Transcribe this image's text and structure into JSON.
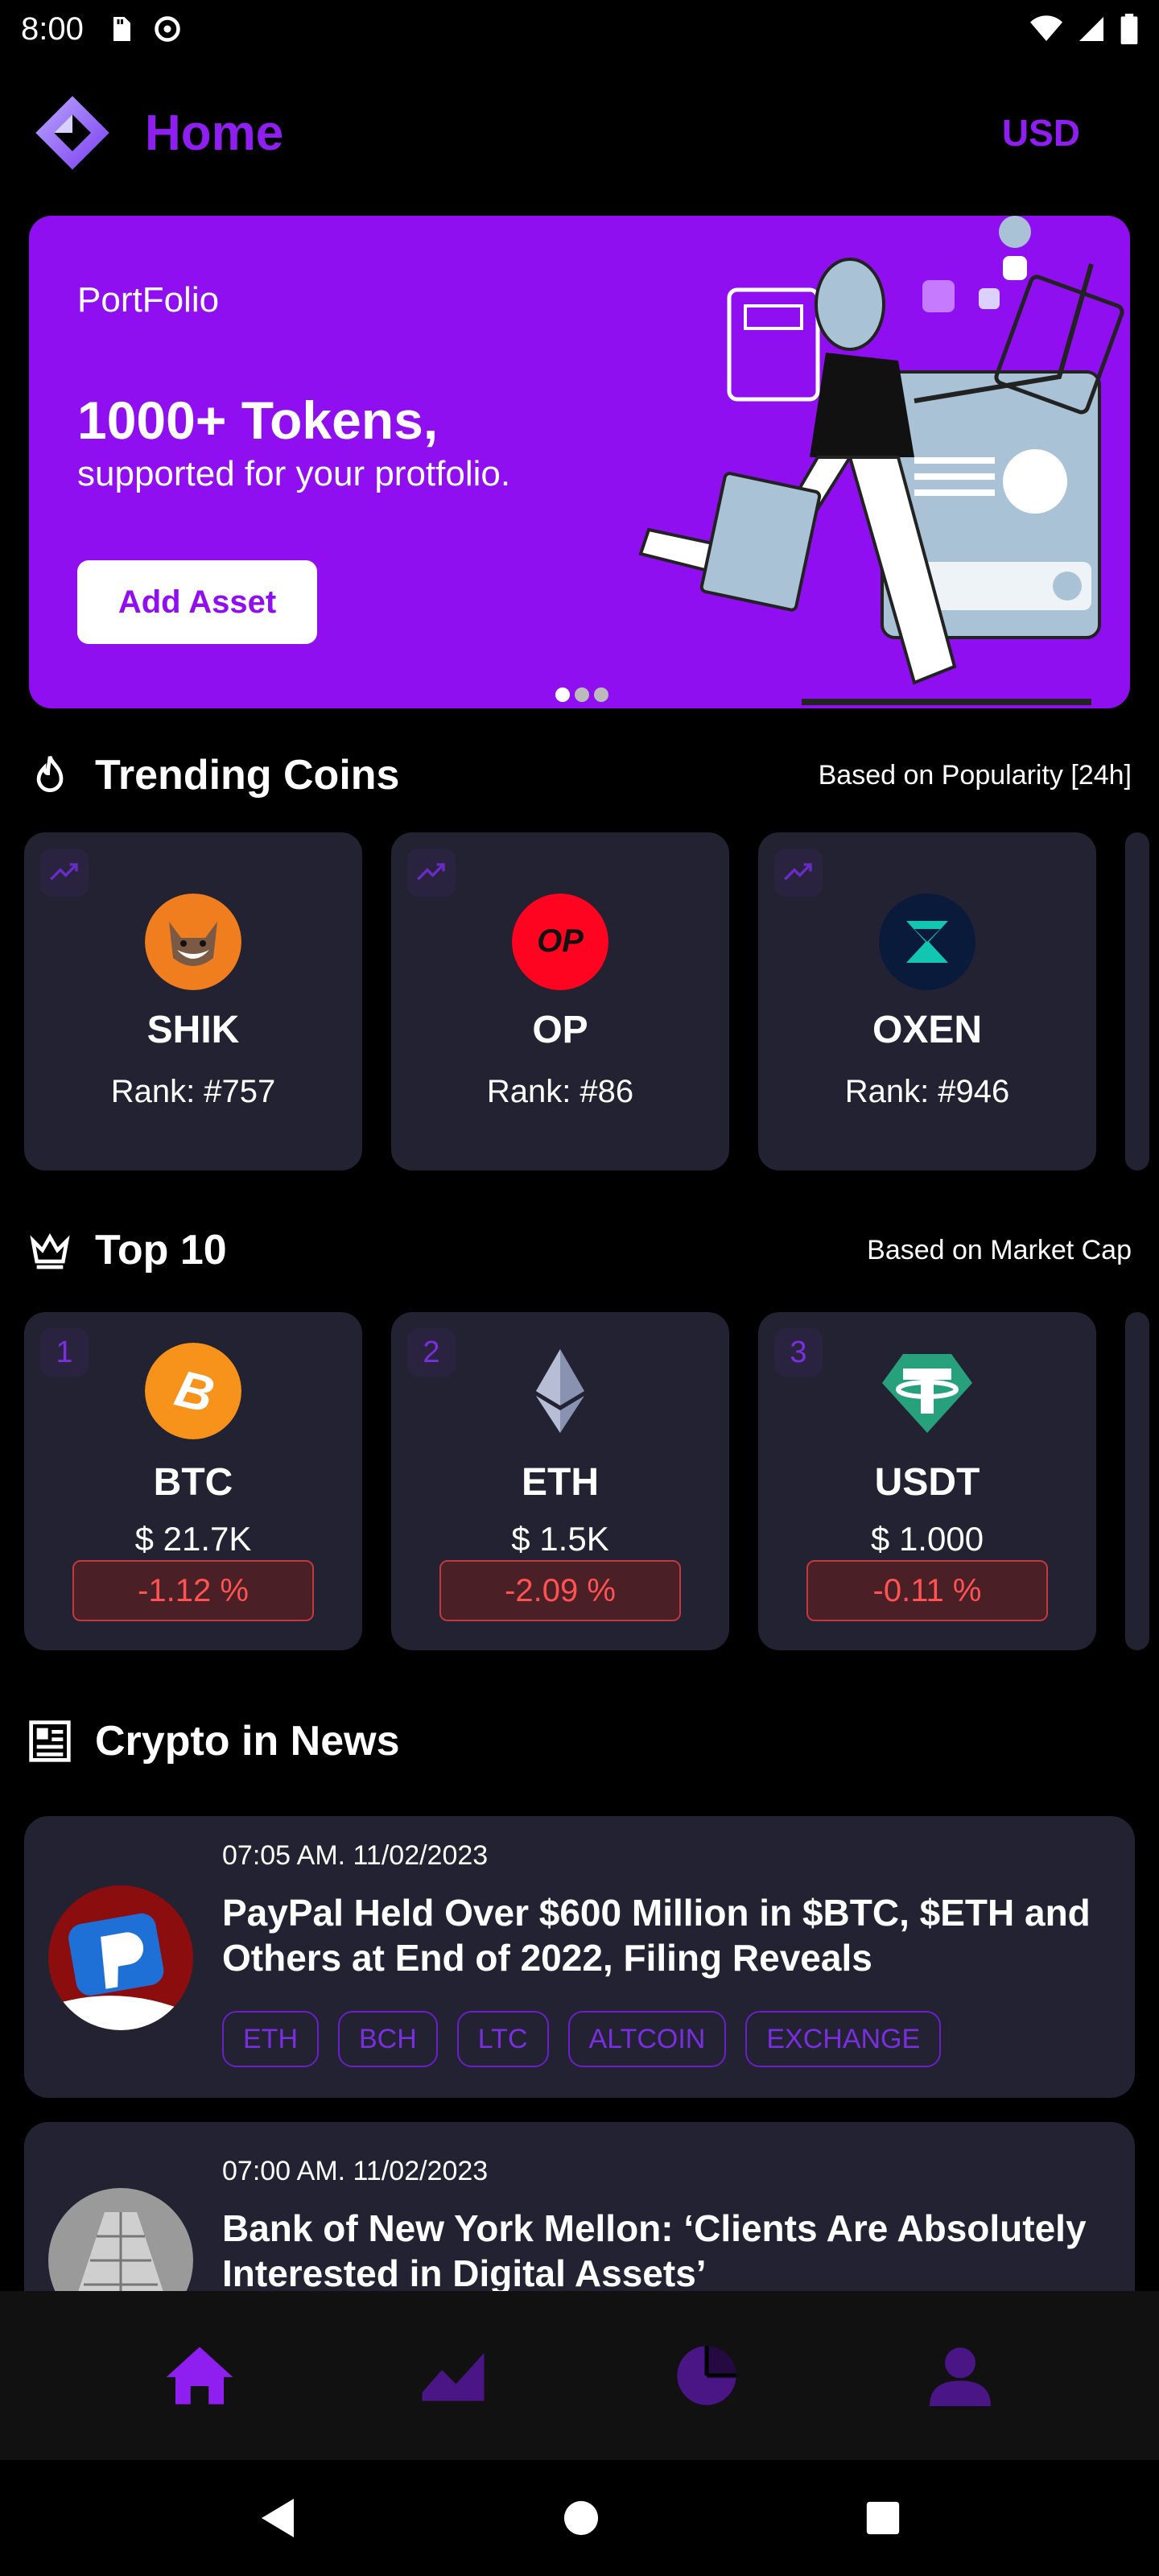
{
  "status_bar": {
    "time": "8:00"
  },
  "header": {
    "title": "Home",
    "currency": "USD"
  },
  "banner": {
    "label": "PortFolio",
    "headline": "1000+ Tokens,",
    "subline": "supported for your protfolio.",
    "button_label": "Add Asset",
    "carousel": {
      "count": 3,
      "active_index": 0
    }
  },
  "trending": {
    "title": "Trending Coins",
    "note": "Based on Popularity [24h]",
    "coins": [
      {
        "symbol": "SHIK",
        "rank": "Rank: #757"
      },
      {
        "symbol": "OP",
        "rank": "Rank: #86"
      },
      {
        "symbol": "OXEN",
        "rank": "Rank: #946"
      }
    ]
  },
  "top10": {
    "title": "Top 10",
    "note": "Based on Market Cap",
    "coins": [
      {
        "rank": "1",
        "symbol": "BTC",
        "price": "$ 21.7K",
        "change": "-1.12 %"
      },
      {
        "rank": "2",
        "symbol": "ETH",
        "price": "$ 1.5K",
        "change": "-2.09 %"
      },
      {
        "rank": "3",
        "symbol": "USDT",
        "price": "$ 1.000",
        "change": "-0.11 %"
      }
    ]
  },
  "news": {
    "title": "Crypto in News",
    "items": [
      {
        "time": "07:05 AM. 11/02/2023",
        "title": "PayPal Held Over $600 Million in $BTC, $ETH and Others at End of 2022, Filing Reveals",
        "tags": [
          "ETH",
          "BCH",
          "LTC",
          "ALTCOIN",
          "EXCHANGE"
        ]
      },
      {
        "time": "07:00 AM. 11/02/2023",
        "title": "Bank of New York Mellon: ‘Clients Are Absolutely Interested in Digital Assets’"
      }
    ]
  },
  "colors": {
    "accent": "#8f1ff0",
    "card_bg": "#222232",
    "negative": "#ff5252"
  }
}
